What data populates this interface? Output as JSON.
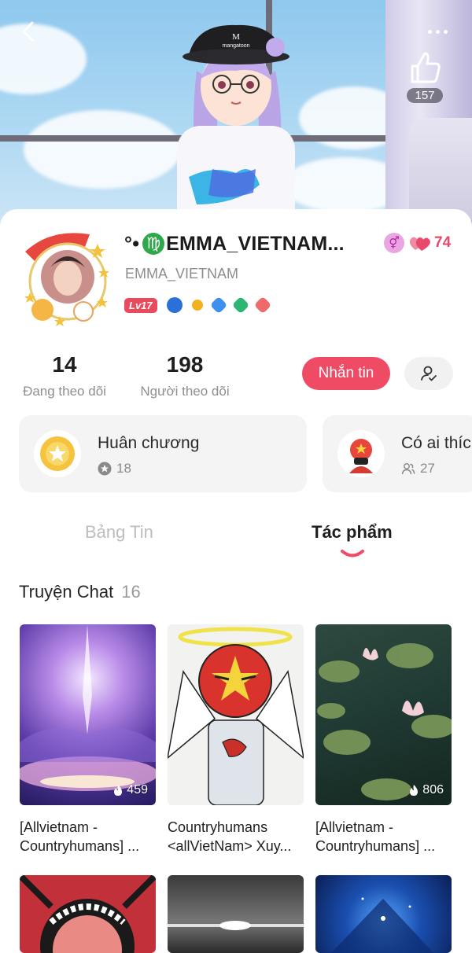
{
  "header": {
    "back_icon": "chevron-left-icon",
    "more_icon": "more-horizontal-icon",
    "like_icon": "thumbs-up-icon",
    "like_count": "157",
    "cap_text": "M\nmangatoon"
  },
  "profile": {
    "name_prefix": "°•",
    "zodiac_symbol": "♍",
    "name": "EMMA_VIETNAM...",
    "username": "EMMA_VIETNAM",
    "gender_symbol": "⚥",
    "heart_count": "74",
    "level": "Lv17",
    "badge_colors": [
      "#2b6fd8",
      "#f2b21f",
      "#3d8ff0",
      "#2bb673",
      "#ef6b6b"
    ]
  },
  "stats": {
    "following_count": "14",
    "following_label": "Đang theo dõi",
    "followers_count": "198",
    "followers_label": "Người theo dõi"
  },
  "actions": {
    "message_label": "Nhắn tin",
    "follow_icon": "user-check-icon"
  },
  "tiles": [
    {
      "title": "Huân chương",
      "count": "18",
      "icon": "medal-icon"
    },
    {
      "title": "Có ai thíc",
      "count": "27",
      "icon": "group-icon"
    }
  ],
  "tabs": [
    {
      "label": "Bảng Tin",
      "active": false
    },
    {
      "label": "Tác phẩm",
      "active": true
    }
  ],
  "section": {
    "title": "Truyện Chat",
    "count": "16"
  },
  "works": [
    {
      "views": "459",
      "caption_1": "[Allvietnam -",
      "caption_2": "Countryhumans] ..."
    },
    {
      "views": "",
      "caption_1": "Countryhumans",
      "caption_2": "<allVietNam> Xuy..."
    },
    {
      "views": "806",
      "caption_1": "[Allvietnam -",
      "caption_2": "Countryhumans] ..."
    }
  ],
  "colors": {
    "accent": "#f04b64",
    "tile_bg": "#f4f4f4"
  }
}
